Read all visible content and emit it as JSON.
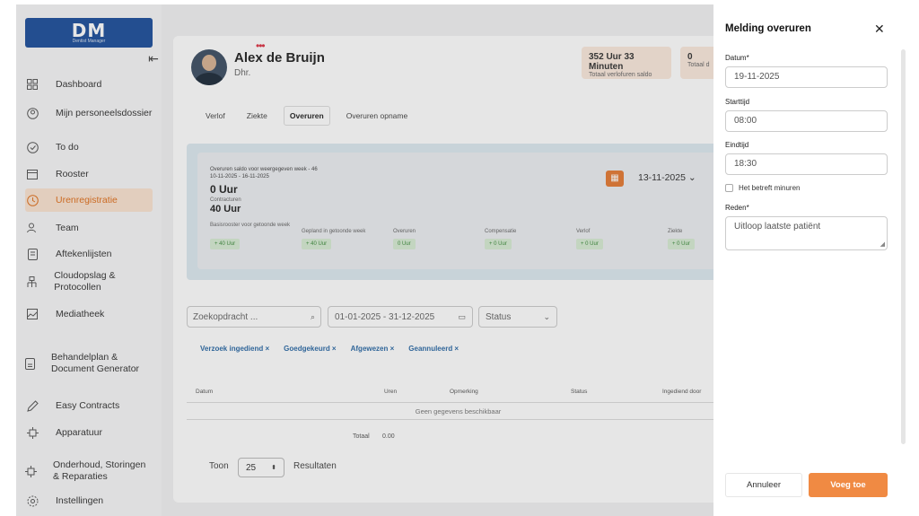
{
  "logo": {
    "mark": "DM",
    "sub": "Dentist Manager"
  },
  "sidebar": {
    "items": [
      {
        "label": "Dashboard",
        "icon": "grid-icon"
      },
      {
        "label": "Mijn personeelsdossier",
        "icon": "user-circle-icon"
      },
      {
        "label": "To do",
        "icon": "check-circle-icon"
      },
      {
        "label": "Rooster",
        "icon": "calendar-icon"
      },
      {
        "label": "Urenregistratie",
        "icon": "clock-icon",
        "active": true
      },
      {
        "label": "Team",
        "icon": "team-icon"
      },
      {
        "label": "Aftekenlijsten",
        "icon": "list-icon"
      },
      {
        "label": "Cloudopslag & Protocollen",
        "icon": "hierarchy-icon"
      },
      {
        "label": "Mediatheek",
        "icon": "image-icon"
      },
      {
        "label": "Behandelplan & Document Generator",
        "icon": "document-icon"
      },
      {
        "label": "Easy Contracts",
        "icon": "pen-icon"
      },
      {
        "label": "Apparatuur",
        "icon": "chip-icon"
      },
      {
        "label": "Onderhoud, Storingen & Reparaties",
        "icon": "chip-icon"
      },
      {
        "label": "Instellingen",
        "icon": "gear-icon"
      }
    ]
  },
  "profile": {
    "name": "Alex de Bruijn",
    "salutation": "Dhr.",
    "dots": "•••"
  },
  "saldo": {
    "value": "352 Uur 33 Minuten",
    "label": "Totaal verlofuren saldo",
    "value2": "0",
    "label2": "Totaal d"
  },
  "tabs": [
    "Verlof",
    "Ziekte",
    "Overuren",
    "Overuren opname"
  ],
  "summary": {
    "heading": "Overuren saldo voor weergegeven week - 46",
    "range": "10-11-2025 - 16-11-2025",
    "saldo": "0 Uur",
    "contract_label": "Contracturen",
    "contract_value": "40 Uur",
    "week_date": "13-11-2025",
    "columns": [
      {
        "label": "Basisrooster voor getoonde week",
        "value": "+ 40 Uur"
      },
      {
        "label": "Gepland in getoonde week",
        "value": "+ 40 Uur"
      },
      {
        "label": "Overuren",
        "value": "0 Uur"
      },
      {
        "label": "Compensatie",
        "value": "+ 0 Uur"
      },
      {
        "label": "Verlof",
        "value": "+ 0 Uur"
      },
      {
        "label": "Ziekte",
        "value": "+ 0 Uur"
      }
    ]
  },
  "filters": {
    "search_placeholder": "Zoekopdracht ...",
    "daterange": "01-01-2025 - 31-12-2025",
    "status": "Status",
    "chips": [
      "Verzoek ingediend ×",
      "Goedgekeurd ×",
      "Afgewezen ×",
      "Geannuleerd ×"
    ]
  },
  "table": {
    "headers": [
      "Datum",
      "Uren",
      "Opmerking",
      "Status",
      "Ingediend door"
    ],
    "empty": "Geen gegevens beschikbaar",
    "total_label": "Totaal",
    "total_value": "0.00"
  },
  "pager": {
    "toon": "Toon",
    "size": "25",
    "resultaten": "Resultaten"
  },
  "panel": {
    "title": "Melding overuren",
    "close": "✕",
    "date_label": "Datum*",
    "date_value": "19-11-2025",
    "start_label": "Starttijd",
    "start_value": "08:00",
    "end_label": "Eindtijd",
    "end_value": "18:30",
    "minus_label": "Het betreft minuren",
    "reason_label": "Reden*",
    "reason_value": "Uitloop laatste patiënt",
    "cancel": "Annuleer",
    "submit": "Voeg toe"
  }
}
